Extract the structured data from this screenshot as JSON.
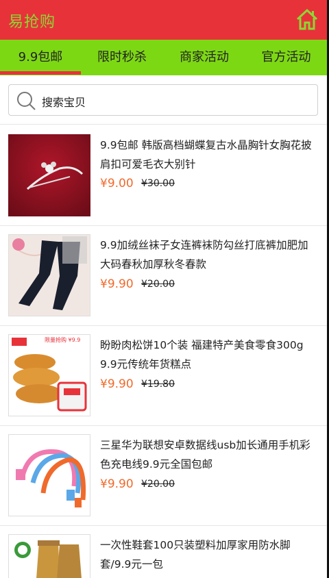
{
  "header": {
    "title": "易抢购",
    "home_icon": "home-icon"
  },
  "tabs": [
    {
      "label": "9.9包邮"
    },
    {
      "label": "限时秒杀"
    },
    {
      "label": "商家活动"
    },
    {
      "label": "官方活动"
    }
  ],
  "search": {
    "placeholder": "搜索宝贝"
  },
  "products": [
    {
      "name": "9.9包邮 韩版高档蝴蝶复古水晶胸针女胸花披肩扣可爱毛衣大别针",
      "price": "¥9.00",
      "old_price": "¥30.00"
    },
    {
      "name": "9.9加绒丝袜子女连裤袜防勾丝打底裤加肥加大码春秋加厚秋冬春款",
      "price": "¥9.90",
      "old_price": "¥20.00"
    },
    {
      "name": "盼盼肉松饼10个装 福建特产美食零食300g 9.9元传统年货糕点",
      "price": "¥9.90",
      "old_price": "¥19.80",
      "thumb_text": "限量抢购 ¥9.9"
    },
    {
      "name": "三星华为联想安卓数据线usb加长通用手机彩色充电线9.9元全国包邮",
      "price": "¥9.90",
      "old_price": "¥20.00"
    },
    {
      "name": "一次性鞋套100只装塑料加厚家用防水脚套/9.9元一包"
    }
  ],
  "colors": {
    "header": "#e8323a",
    "tabs": "#7dd814",
    "price": "#f06a2c"
  }
}
